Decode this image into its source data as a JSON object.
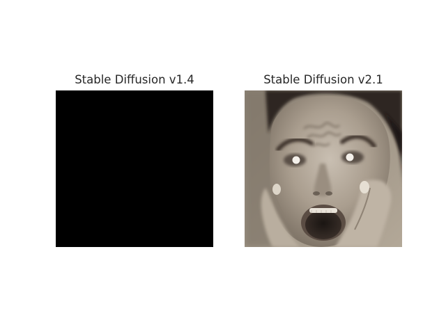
{
  "figure": {
    "panels": [
      {
        "title": "Stable Diffusion v1.4",
        "image": "solid black image"
      },
      {
        "title": "Stable Diffusion v2.1",
        "image": "sepia photo of a screaming woman holding her face"
      }
    ],
    "colors": {
      "background": "#ffffff",
      "title_text": "#262626",
      "black_image": "#000000",
      "sepia_mid": "#9e9384"
    }
  }
}
